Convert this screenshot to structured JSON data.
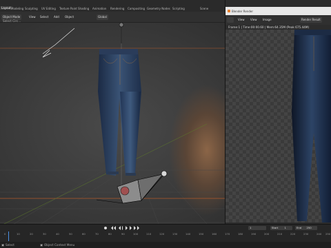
{
  "workspace_tabs": [
    "Layout",
    "Modeling",
    "Sculpting",
    "UV Editing",
    "Texture Paint",
    "Shading",
    "Animation",
    "Rendering",
    "Compositing",
    "Geometry Nodes",
    "Scripting"
  ],
  "active_tab": "Layout",
  "header": {
    "mode": "Object Mode",
    "view": "View",
    "select": "Select",
    "add": "Add",
    "object": "Object",
    "transform": "Global",
    "select_circle": "Select Circ..."
  },
  "scene_label": "Scene",
  "render_window": {
    "title": "Blender Render",
    "menu": [
      "View",
      "View",
      "Image"
    ],
    "slot": "Render Result",
    "stats": "Frame:1 | Time:00:00.60 | Mem:64.35M (Peak 675.44M)"
  },
  "timeline": {
    "ruler": [
      "0",
      "10",
      "20",
      "30",
      "40",
      "50",
      "60",
      "70",
      "80",
      "90",
      "100",
      "110",
      "120",
      "130",
      "140",
      "150",
      "160",
      "170",
      "180",
      "190",
      "200",
      "210",
      "220",
      "230",
      "240",
      "250"
    ],
    "current_frame": "1",
    "start_label": "Start",
    "start": "1",
    "end_label": "End",
    "end": "250"
  },
  "status": {
    "select": "Select",
    "context": "Object Context Menu"
  },
  "colors": {
    "accent": "#e77e2a",
    "viewport": "#3a3a3a"
  }
}
